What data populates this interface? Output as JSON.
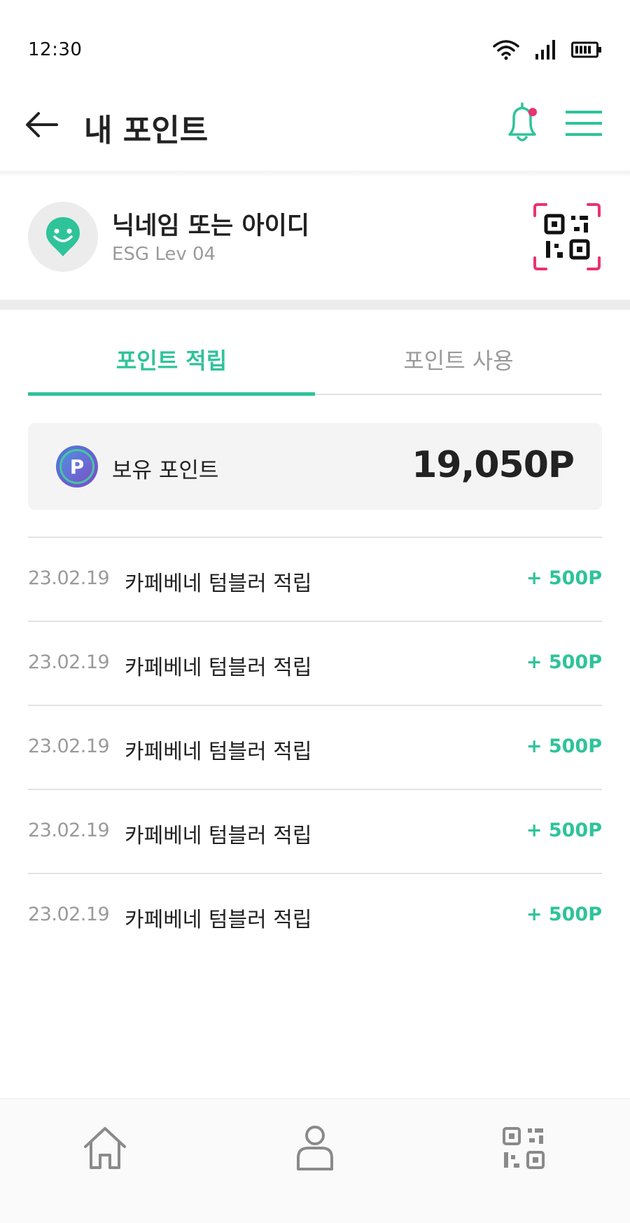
{
  "status_bar": {
    "time": "12:30",
    "icons": [
      "wifi-icon",
      "signal-icon",
      "battery-icon"
    ]
  },
  "header": {
    "title": "내 포인트",
    "back_icon": "back-arrow-icon",
    "notification_icon": "bell-icon",
    "menu_icon": "hamburger-menu-icon"
  },
  "profile": {
    "nickname": "닉네임 또는 아이디",
    "level": "ESG Lev 04",
    "avatar_icon": "smile-pin-icon",
    "qr_icon": "qr-scan-icon"
  },
  "tabs": [
    {
      "label": "포인트 적립",
      "active": true
    },
    {
      "label": "포인트 사용",
      "active": false
    }
  ],
  "points": {
    "icon_letter": "P",
    "label": "보유 포인트",
    "value": "19,050P"
  },
  "history": [
    {
      "date": "23.02.19",
      "description": "카페베네 텀블러 적립",
      "amount": "+ 500P"
    },
    {
      "date": "23.02.19",
      "description": "카페베네 텀블러 적립",
      "amount": "+ 500P"
    },
    {
      "date": "23.02.19",
      "description": "카페베네 텀블러 적립",
      "amount": "+ 500P"
    },
    {
      "date": "23.02.19",
      "description": "카페베네 텀블러 적립",
      "amount": "+ 500P"
    },
    {
      "date": "23.02.19",
      "description": "카페베네 텀블러 적립",
      "amount": "+ 500P"
    }
  ],
  "bottom_nav": [
    {
      "icon": "home-icon"
    },
    {
      "icon": "user-icon"
    },
    {
      "icon": "qr-code-icon"
    }
  ],
  "colors": {
    "accent": "#2fc39a",
    "qr_frame": "#e8336f",
    "notification_dot": "#e8336f"
  }
}
